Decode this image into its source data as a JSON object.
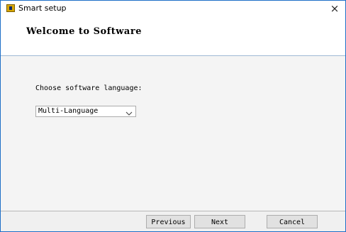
{
  "window": {
    "title": "Smart setup",
    "close_label": "×"
  },
  "header": {
    "welcome": "Welcome to Software"
  },
  "content": {
    "language_label": "Choose software language:",
    "language_selected": "Multi-Language"
  },
  "footer": {
    "previous_label": "Previous",
    "next_label": "Next",
    "cancel_label": "Cancel"
  },
  "colors": {
    "window_border": "#1e6fc7",
    "panel_bg": "#f4f4f4",
    "button_bg": "#e1e1e1"
  }
}
